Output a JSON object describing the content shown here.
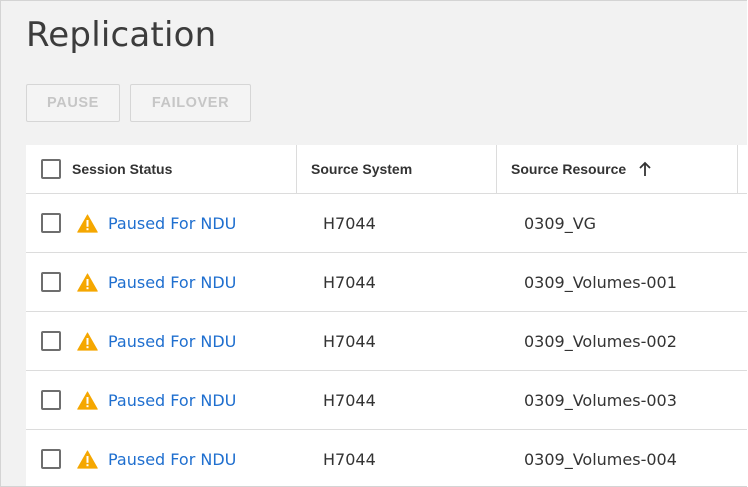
{
  "page": {
    "title": "Replication"
  },
  "toolbar": {
    "pause_label": "PAUSE",
    "failover_label": "FAILOVER"
  },
  "table": {
    "columns": [
      {
        "label": "Session Status"
      },
      {
        "label": "Source System"
      },
      {
        "label": "Source Resource",
        "sort": "ascending"
      }
    ],
    "rows": [
      {
        "status": "Paused For NDU",
        "source_system": "H7044",
        "source_resource": "0309_VG"
      },
      {
        "status": "Paused For NDU",
        "source_system": "H7044",
        "source_resource": "0309_Volumes-001"
      },
      {
        "status": "Paused For NDU",
        "source_system": "H7044",
        "source_resource": "0309_Volumes-002"
      },
      {
        "status": "Paused For NDU",
        "source_system": "H7044",
        "source_resource": "0309_Volumes-003"
      },
      {
        "status": "Paused For NDU",
        "source_system": "H7044",
        "source_resource": "0309_Volumes-004"
      }
    ]
  },
  "icons": {
    "status_warning": "warning-icon",
    "sort": "arrow-up-icon"
  },
  "colors": {
    "link": "#1f6fcf",
    "warning": "#f5a700",
    "disabled_text": "#c6c6c6",
    "background": "#f2f2f2"
  }
}
